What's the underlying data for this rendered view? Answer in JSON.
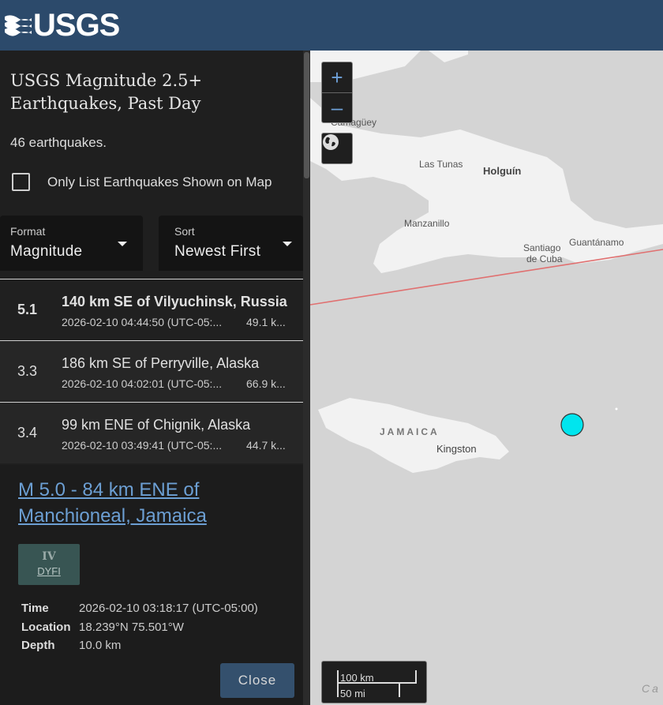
{
  "header": {
    "logo_text": "USGS",
    "colors": {
      "bar": "#2c4a6b",
      "logo": "#ffffff"
    },
    "logo_icon": "usgs-waves-icon"
  },
  "sidebar": {
    "title": "USGS Magnitude 2.5+ Earthquakes, Past Day",
    "count_text": "46 earthquakes.",
    "only_list_label": "Only List Earthquakes Shown on Map",
    "only_list_checked": false,
    "format": {
      "label": "Format",
      "value": "Magnitude"
    },
    "sort": {
      "label": "Sort",
      "value": "Newest First"
    }
  },
  "earthquakes": [
    {
      "mag": "5.1",
      "place": "140 km SE of Vilyuchinsk, Russia",
      "time": "2026-02-10 04:44:50 (UTC-05:...",
      "depth": "49.1 k...",
      "selected": true
    },
    {
      "mag": "3.3",
      "place": "186 km SE of Perryville, Alaska",
      "time": "2026-02-10 04:02:01 (UTC-05:...",
      "depth": "66.9 k...",
      "selected": false
    },
    {
      "mag": "3.4",
      "place": "99 km ENE of Chignik, Alaska",
      "time": "2026-02-10 03:49:41 (UTC-05:...",
      "depth": "44.7 k...",
      "selected": false
    }
  ],
  "popup": {
    "title": "M 5.0 - 84 km ENE of Manchioneal, Jamaica",
    "dyfi_value": "IV",
    "dyfi_label": "DYFI",
    "details": [
      {
        "key": "Time",
        "value": "2026-02-10 03:18:17 (UTC-05:00)"
      },
      {
        "key": "Location",
        "value": "18.239°N 75.501°W"
      },
      {
        "key": "Depth",
        "value": "10.0 km"
      }
    ],
    "close_label": "Close",
    "link_color": "#6c9fd3"
  },
  "map": {
    "zoom_in": "+",
    "zoom_out": "–",
    "labels": {
      "camaguey": "Camagüey",
      "las_tunas": "Las Tunas",
      "holguin": "Holguín",
      "manzanillo": "Manzanillo",
      "santiago": "Santiago",
      "de_cuba": "de Cuba",
      "guantanamo": "Guantánamo",
      "jamaica": "JAMAICA",
      "kingston": "Kingston",
      "sea": "Ca"
    },
    "scale": {
      "km": "100 km",
      "mi": "50 mi"
    },
    "marker_color": "#00e5ee",
    "plate_line_color": "#e07070"
  }
}
